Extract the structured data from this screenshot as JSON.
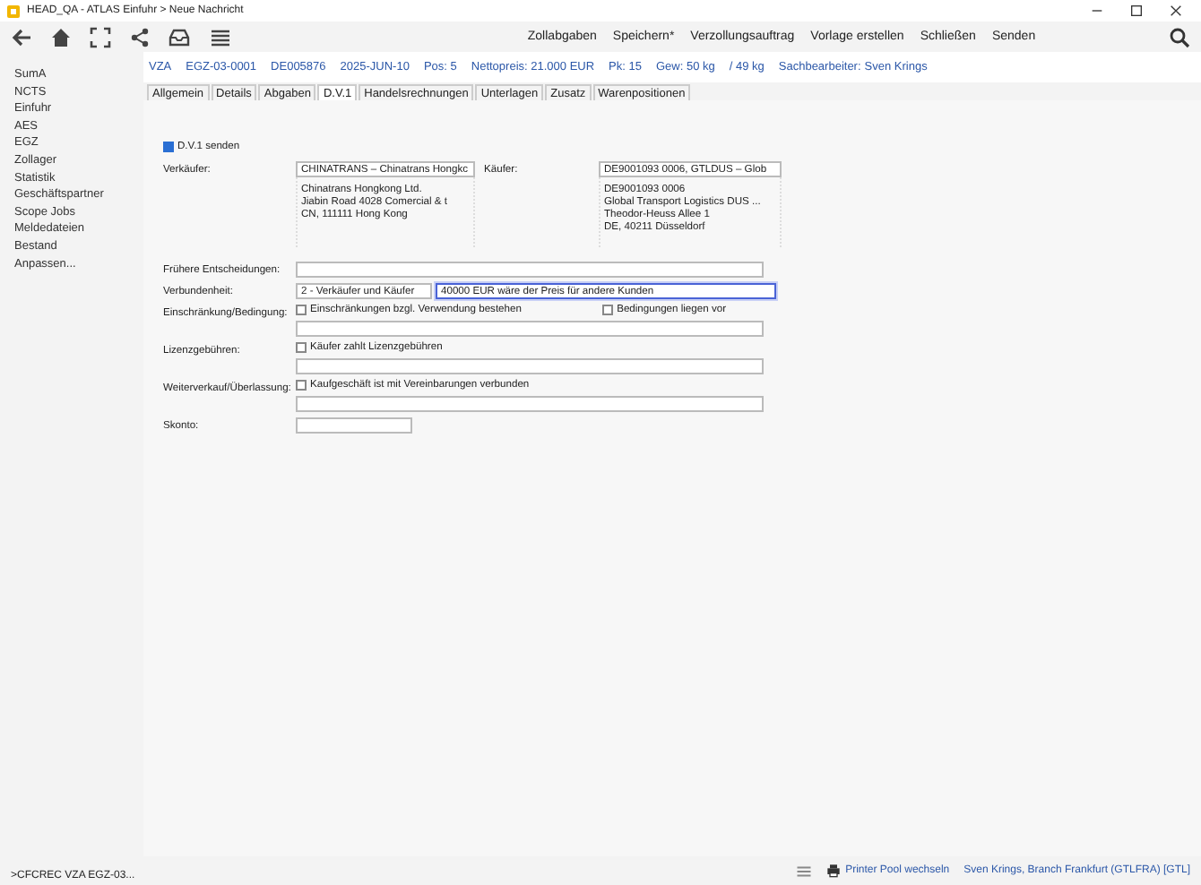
{
  "window": {
    "title": "HEAD_QA - ATLAS Einfuhr > Neue Nachricht"
  },
  "toolbar": {
    "actions": [
      "Zollabgaben",
      "Speichern*",
      "Verzollungsauftrag",
      "Vorlage erstellen",
      "Schließen",
      "Senden"
    ]
  },
  "sidebar": {
    "items": [
      "SumA",
      "NCTS",
      "Einfuhr",
      "AES",
      "EGZ",
      "Zollager",
      "Statistik",
      "Geschäftspartner",
      "Scope Jobs",
      "Meldedateien",
      "Bestand",
      "Anpassen..."
    ]
  },
  "info_bar": {
    "items": [
      "VZA",
      "EGZ-03-0001",
      "DE005876",
      "2025-JUN-10",
      "Pos: 5",
      "Nettopreis: 21.000 EUR",
      "Pk: 15",
      "Gew: 50 kg",
      "/ 49 kg"
    ],
    "clerk_label": "Sachbearbeiter:",
    "clerk": "Sven Krings"
  },
  "tabs": [
    {
      "label": "Allgemein",
      "selected": false
    },
    {
      "label": "Details",
      "selected": false
    },
    {
      "label": "Abgaben",
      "selected": false
    },
    {
      "label": "D.V.1",
      "selected": true
    },
    {
      "label": "Handelsrechnungen",
      "selected": false
    },
    {
      "label": "Unterlagen",
      "selected": false
    },
    {
      "label": "Zusatz",
      "selected": false
    },
    {
      "label": "Warenpositionen",
      "selected": false
    }
  ],
  "send_checkbox": {
    "label": "D.V.1 senden",
    "checked": true
  },
  "parties": [
    {
      "label": "Verkäufer:",
      "value": "CHINATRANS – Chinatrans Hongkc",
      "address": [
        "Chinatrans Hongkong Ltd.",
        "Jiabin Road 4028 Comercial & t",
        "CN, 111111 Hong Kong"
      ]
    },
    {
      "label": "Käufer:",
      "value": "DE9001093 0006, GTLDUS – Glob",
      "address": [
        "DE9001093 0006",
        "Global Transport Logistics DUS ...",
        "Theodor-Heuss Allee 1",
        "DE, 40211 Düsseldorf"
      ]
    }
  ],
  "rows": [
    {
      "kind": "text",
      "label": "Frühere Entscheidungen:"
    },
    {
      "kind": "select",
      "label": "Verbundenheit:",
      "value": "2 - Verkäufer und Käufer",
      "detail": "40000 EUR wäre der Preis für andere Kunden",
      "focused": true
    },
    {
      "kind": "checks",
      "label": "Einschränkung/Bedingung:",
      "checks": [
        {
          "label": "Einschränkungen bzgl. Verwendung bestehen",
          "checked": false
        },
        {
          "label": "Bedingungen liegen vor",
          "checked": false
        }
      ]
    },
    {
      "kind": "checks",
      "label": "Lizenzgebühren:",
      "checks": [
        {
          "label": "Käufer zahlt Lizenzgebühren",
          "checked": false
        }
      ]
    },
    {
      "kind": "checks",
      "label": "Weiterverkauf/Überlassung:",
      "checks": [
        {
          "label": "Kaufgeschäft ist mit Vereinbarungen verbunden",
          "checked": false
        }
      ]
    },
    {
      "kind": "short",
      "label": "Skonto:"
    }
  ],
  "status_bar": {
    "command": ">CFCREC VZA EGZ-03...",
    "printer": "Printer Pool wechseln",
    "user": "Sven Krings, Branch Frankfurt (GTLFRA) [GTL]"
  }
}
